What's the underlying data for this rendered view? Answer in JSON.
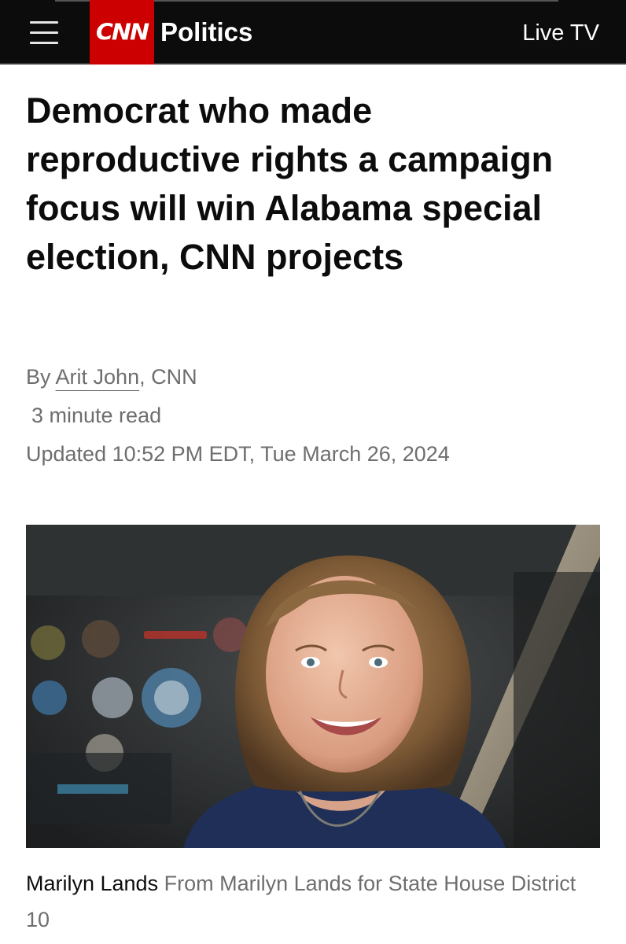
{
  "header": {
    "menu_icon": "hamburger-menu-icon",
    "logo_text": "CNN",
    "section": "Politics",
    "live_tv": "Live TV",
    "colors": {
      "bar": "#0c0c0c",
      "logo": "#cc0000"
    }
  },
  "article": {
    "headline": "Democrat who made reproductive rights a campaign focus will win Alabama special election, CNN projects",
    "byline_prefix": "By",
    "author": "Arit John",
    "outlet": ", CNN",
    "read_time": "3 minute read",
    "updated": "Updated 10:52 PM EDT, Tue March 26, 2024"
  },
  "image": {
    "subject": "photo-of-woman-smiling",
    "caption_name": "Marilyn Lands",
    "caption_credit": "From Marilyn Lands for State House District 10"
  }
}
